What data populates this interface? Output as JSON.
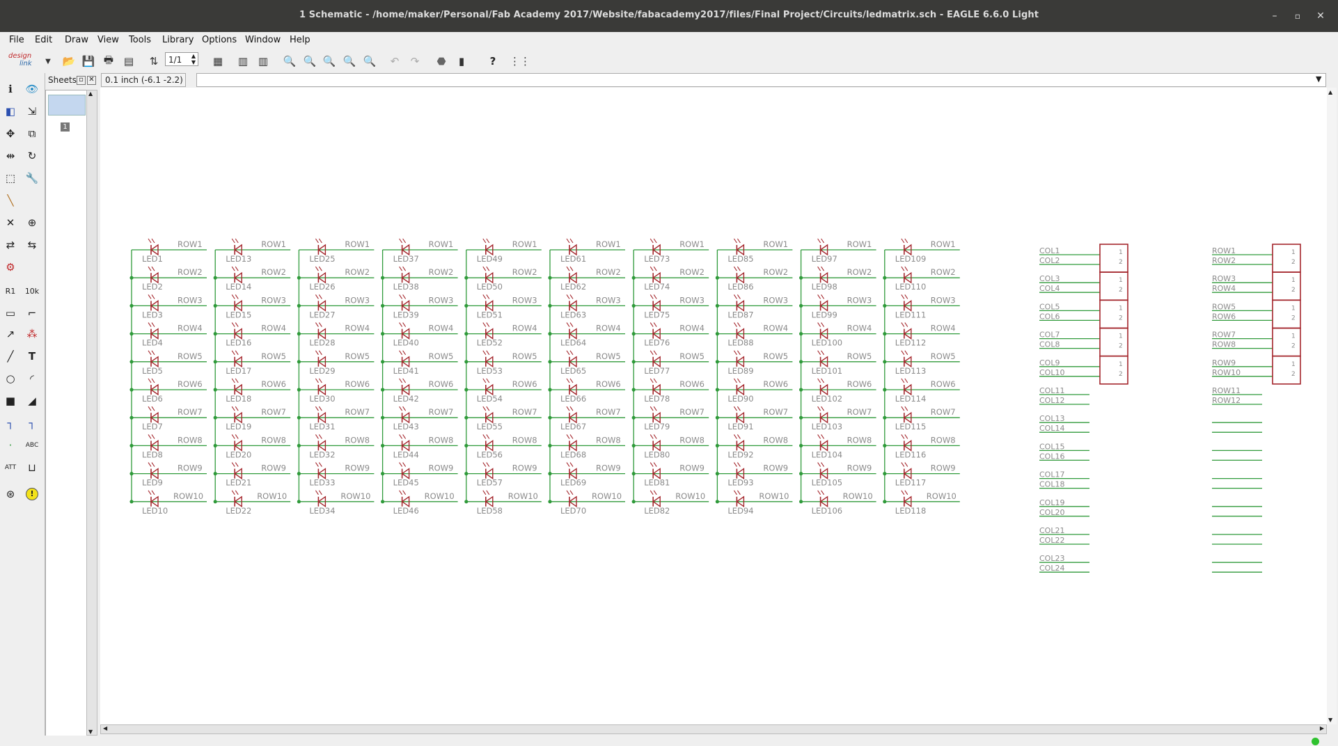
{
  "window": {
    "title": "1 Schematic - /home/maker/Personal/Fab Academy 2017/Website/fabacademy2017/files/Final Project/Circuits/ledmatrix.sch - EAGLE 6.6.0 Light",
    "minimize": "–",
    "maximize": "▫",
    "close": "✕"
  },
  "menu": [
    "File",
    "Edit",
    "Draw",
    "View",
    "Tools",
    "Library",
    "Options",
    "Window",
    "Help"
  ],
  "toolbar": {
    "logo_top": "design",
    "logo_bottom": "link",
    "sheet_select": "1/1"
  },
  "coord_display": "0.1 inch (-6.1 -2.2)",
  "sheets_panel": {
    "title": "Sheets",
    "sheet_number": "1"
  },
  "schematic": {
    "row_labels": [
      "ROW1",
      "ROW2",
      "ROW3",
      "ROW4",
      "ROW5",
      "ROW6",
      "ROW7",
      "ROW8",
      "ROW9",
      "ROW10"
    ],
    "led_columns": [
      [
        "LED1",
        "LED2",
        "LED3",
        "LED4",
        "LED5",
        "LED6",
        "LED7",
        "LED8",
        "LED9",
        "LED10"
      ],
      [
        "LED13",
        "LED14",
        "LED15",
        "LED16",
        "LED17",
        "LED18",
        "LED19",
        "LED20",
        "LED21",
        "LED22"
      ],
      [
        "LED25",
        "LED26",
        "LED27",
        "LED28",
        "LED29",
        "LED30",
        "LED31",
        "LED32",
        "LED33",
        "LED34"
      ],
      [
        "LED37",
        "LED38",
        "LED39",
        "LED40",
        "LED41",
        "LED42",
        "LED43",
        "LED44",
        "LED45",
        "LED46"
      ],
      [
        "LED49",
        "LED50",
        "LED51",
        "LED52",
        "LED53",
        "LED54",
        "LED55",
        "LED56",
        "LED57",
        "LED58"
      ],
      [
        "LED61",
        "LED62",
        "LED63",
        "LED64",
        "LED65",
        "LED66",
        "LED67",
        "LED68",
        "LED69",
        "LED70"
      ],
      [
        "LED73",
        "LED74",
        "LED75",
        "LED76",
        "LED77",
        "LED78",
        "LED79",
        "LED80",
        "LED81",
        "LED82"
      ],
      [
        "LED85",
        "LED86",
        "LED87",
        "LED88",
        "LED89",
        "LED90",
        "LED91",
        "LED92",
        "LED93",
        "LED94"
      ],
      [
        "LED97",
        "LED98",
        "LED99",
        "LED100",
        "LED101",
        "LED102",
        "LED103",
        "LED104",
        "LED105",
        "LED106"
      ],
      [
        "LED109",
        "LED110",
        "LED111",
        "LED112",
        "LED113",
        "LED114",
        "LED115",
        "LED116",
        "LED117",
        "LED118"
      ]
    ],
    "col_nets": [
      "COL1",
      "COL2",
      "COL3",
      "COL4",
      "COL5",
      "COL6",
      "COL7",
      "COL8",
      "COL9",
      "COL10",
      "COL11",
      "COL12",
      "COL13",
      "COL14",
      "COL15",
      "COL16",
      "COL17",
      "COL18",
      "COL19",
      "COL20",
      "COL21",
      "COL22",
      "COL23",
      "COL24"
    ],
    "row_nets": [
      "ROW1",
      "ROW2",
      "ROW3",
      "ROW4",
      "ROW5",
      "ROW6",
      "ROW7",
      "ROW8",
      "ROW9",
      "ROW10",
      "ROW11",
      "ROW12"
    ],
    "pin_numbers": [
      "1",
      "2"
    ],
    "colors": {
      "symbol": "#a4262c",
      "net": "#2f9a3a",
      "text": "#8a8a8a"
    }
  }
}
